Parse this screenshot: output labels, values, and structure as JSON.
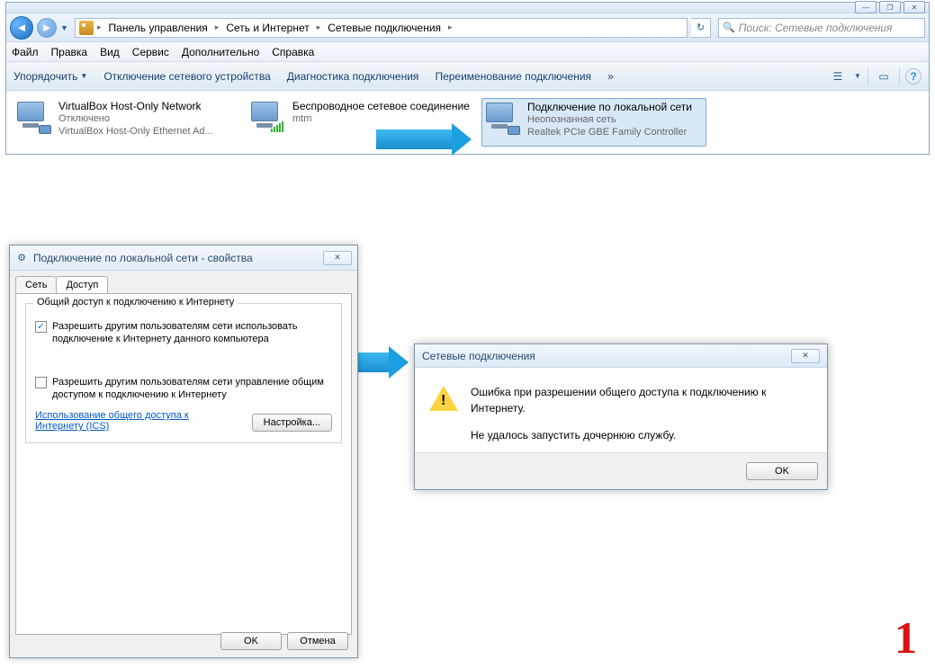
{
  "window_controls": {
    "min": "—",
    "max": "❐",
    "close": "✕"
  },
  "nav": {
    "back": "◄",
    "fwd": "►",
    "dd": "▼",
    "refresh": "↻"
  },
  "breadcrumbs": {
    "sep": "▸",
    "items": [
      "Панель управления",
      "Сеть и Интернет",
      "Сетевые подключения"
    ]
  },
  "search": {
    "placeholder": "Поиск: Сетевые подключения",
    "icon": "🔍"
  },
  "menu": {
    "items": [
      "Файл",
      "Правка",
      "Вид",
      "Сервис",
      "Дополнительно",
      "Справка"
    ]
  },
  "toolbar": {
    "items": [
      "Упорядочить",
      "Отключение сетевого устройства",
      "Диагностика подключения",
      "Переименование подключения"
    ],
    "overflow": "»",
    "view_icon": "☰",
    "view_dd": "▼",
    "pane_icon": "▭",
    "help_icon": "?"
  },
  "connections": [
    {
      "name": "VirtualBox Host-Only Network",
      "status": "Отключено",
      "adapter": "VirtualBox Host-Only Ethernet Ad..."
    },
    {
      "name": "Беспроводное сетевое соединение",
      "status": "",
      "adapter": "mtm"
    },
    {
      "name": "Подключение по локальной сети",
      "status": "Неопознанная сеть",
      "adapter": "Realtek PCIe GBE Family Controller"
    }
  ],
  "props": {
    "title": "Подключение по локальной сети - свойства",
    "icon": "⚙",
    "close": "✕",
    "tabs": [
      "Сеть",
      "Доступ"
    ],
    "group_title": "Общий доступ к подключению к Интернету",
    "chk1": "Разрешить другим пользователям сети использовать подключение к Интернету данного компьютера",
    "chk1_checked": "✓",
    "chk2": "Разрешить другим пользователям сети управление общим доступом к подключению к Интернету",
    "link": "Использование общего доступа к Интернету (ICS)",
    "settings_btn": "Настройка...",
    "ok": "OK",
    "cancel": "Отмена"
  },
  "error": {
    "title": "Сетевые подключения",
    "close": "✕",
    "line1": "Ошибка при разрешении общего доступа к подключению к Интернету.",
    "line2": "Не удалось запустить дочернюю службу.",
    "ok": "OK",
    "bang": "!"
  },
  "annotation": "1"
}
